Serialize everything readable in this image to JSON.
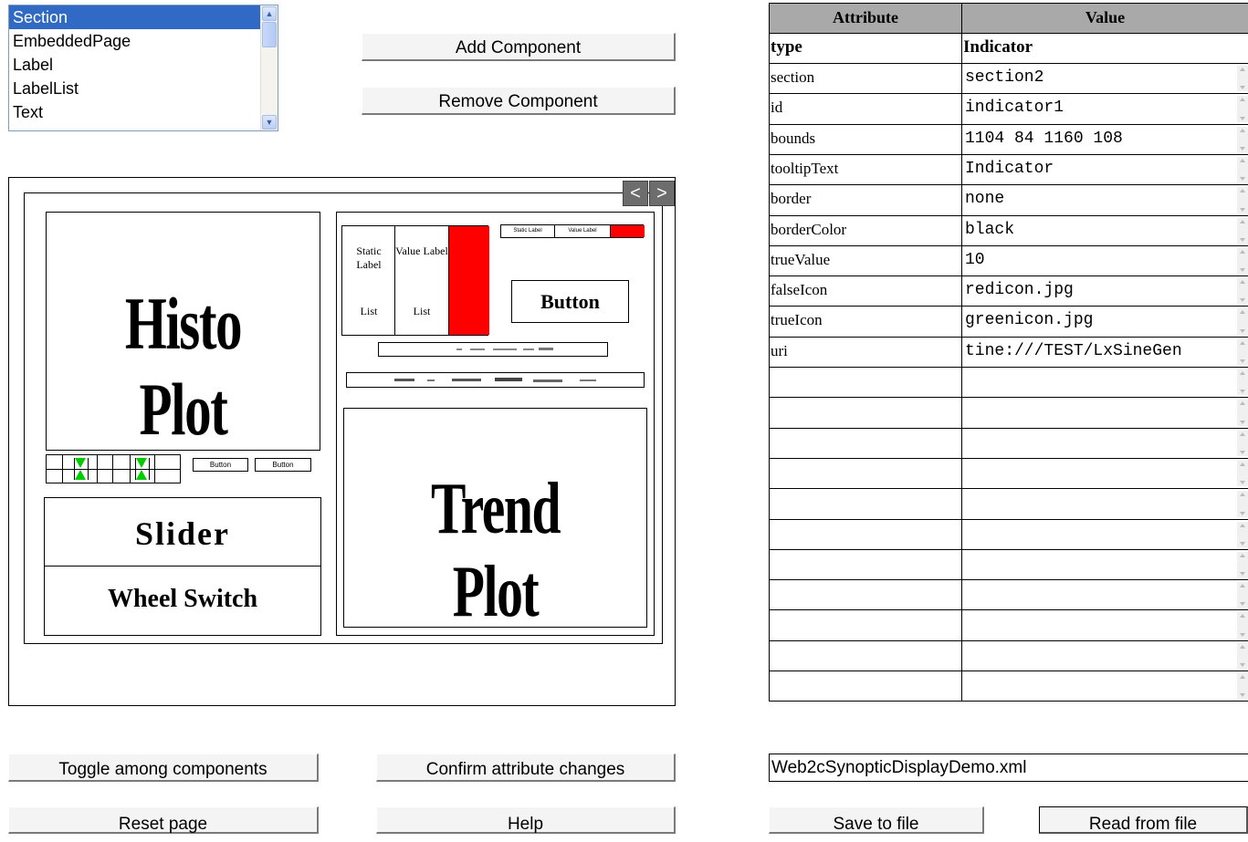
{
  "component_list": {
    "items": [
      "Section",
      "EmbeddedPage",
      "Label",
      "LabelList",
      "Text"
    ],
    "selected": "Section"
  },
  "buttons": {
    "add_component": "Add Component",
    "remove_component": "Remove Component",
    "toggle_components": "Toggle among components",
    "confirm_changes": "Confirm attribute changes",
    "reset_page": "Reset page",
    "help": "Help",
    "save_to_file": "Save to file",
    "read_from_file": "Read from file"
  },
  "canvas": {
    "nav_prev": "<",
    "nav_next": ">",
    "histo_plot": "Histo Plot",
    "slider": "Slider",
    "wheel_switch": "Wheel Switch",
    "trend_plot": "Trend Plot",
    "button": "Button",
    "static_label": "Static Label",
    "value_label": "Value Label",
    "list1": "List",
    "list2": "List",
    "small_static_label": "Static Label",
    "small_value_label": "Value Label",
    "small_button1": "Button",
    "small_button2": "Button"
  },
  "attribute_table": {
    "header_attribute": "Attribute",
    "header_value": "Value",
    "type_label": "type",
    "type_value": "Indicator",
    "rows": [
      {
        "attr": "section",
        "value": "section2"
      },
      {
        "attr": "id",
        "value": "indicator1"
      },
      {
        "attr": "bounds",
        "value": "1104 84 1160 108"
      },
      {
        "attr": "tooltipText",
        "value": "Indicator"
      },
      {
        "attr": "border",
        "value": "none"
      },
      {
        "attr": "borderColor",
        "value": "black"
      },
      {
        "attr": "trueValue",
        "value": "10"
      },
      {
        "attr": "falseIcon",
        "value": "redicon.jpg"
      },
      {
        "attr": "trueIcon",
        "value": "greenicon.jpg"
      },
      {
        "attr": "uri",
        "value": "tine:///TEST/LxSineGen"
      },
      {
        "attr": "",
        "value": ""
      },
      {
        "attr": "",
        "value": ""
      },
      {
        "attr": "",
        "value": ""
      },
      {
        "attr": "",
        "value": ""
      },
      {
        "attr": "",
        "value": ""
      },
      {
        "attr": "",
        "value": ""
      },
      {
        "attr": "",
        "value": ""
      },
      {
        "attr": "",
        "value": ""
      },
      {
        "attr": "",
        "value": ""
      },
      {
        "attr": "",
        "value": ""
      },
      {
        "attr": "",
        "value": ""
      }
    ]
  },
  "file": {
    "name": "Web2cSynopticDisplayDemo.xml"
  },
  "colors": {
    "selection": "#316ac5",
    "header_bg": "#a9a9a9",
    "indicator_red": "#ff0000",
    "arrow_green": "#00cc00"
  }
}
